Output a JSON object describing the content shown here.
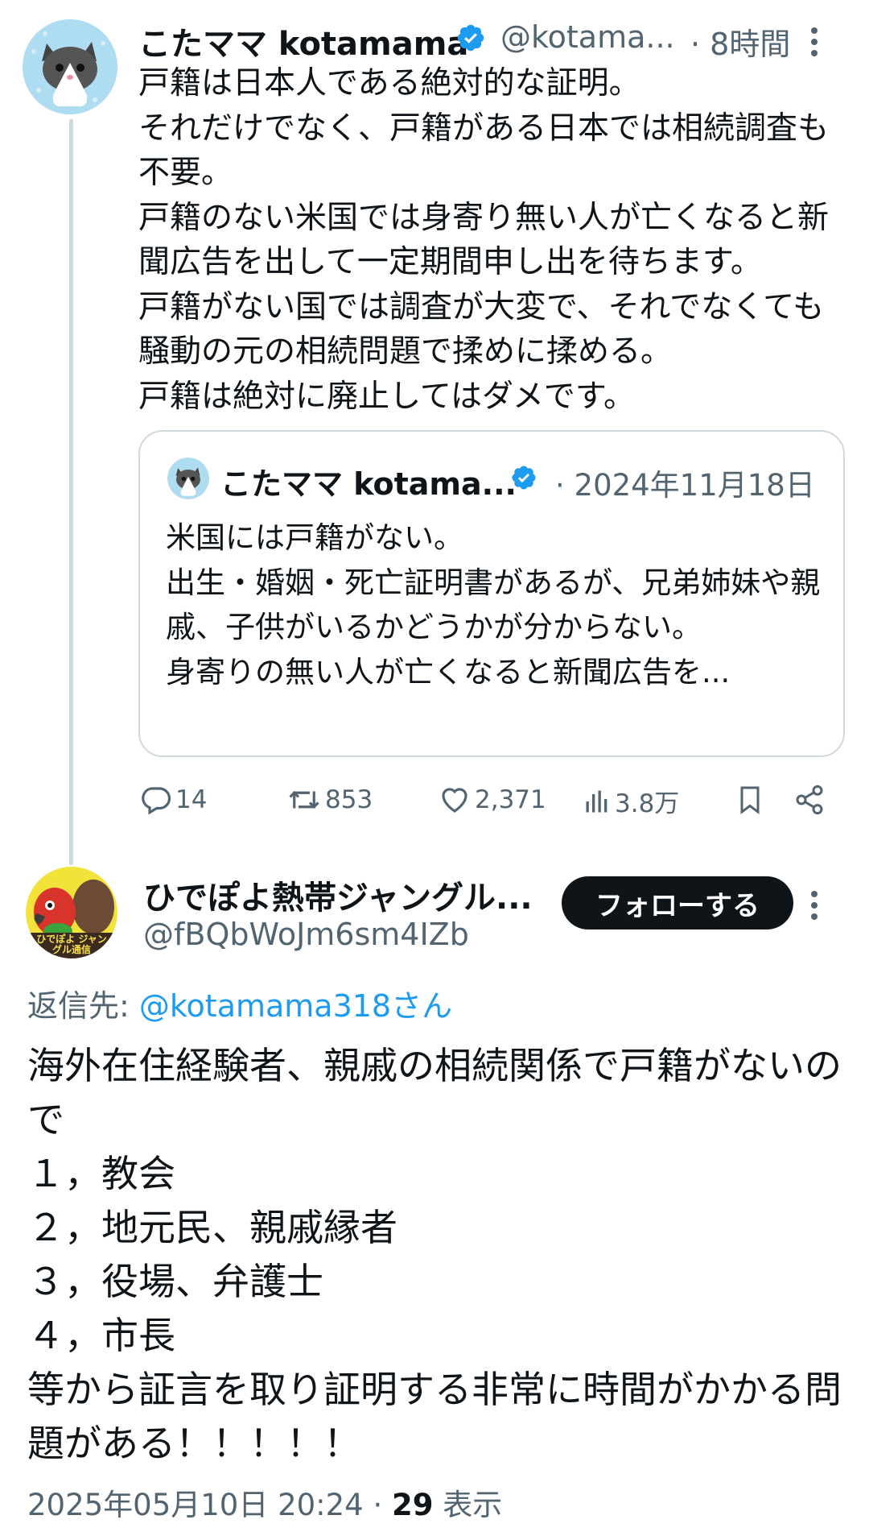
{
  "tweet": {
    "author_name": "こたママ kotamama",
    "author_handle": "@kotama...",
    "time": "· 8時間",
    "body": "戸籍は日本人である絶対的な証明。\nそれだけでなく、戸籍がある日本では相続調査も不要。\n戸籍のない米国では身寄り無い人が亡くなると新聞広告を出して一定期間申し出を待ちます。\n戸籍がない国では調査が大変で、それでなくても騒動の元の相続問題で揉めに揉める。\n戸籍は絶対に廃止してはダメです。",
    "quote": {
      "author_name": "こたママ kotama...",
      "date": "· 2024年11月18日",
      "body": "米国には戸籍がない。\n出生・婚姻・死亡証明書があるが、兄弟姉妹や親戚、子供がいるかどうかが分からない。\n身寄りの無い人が亡くなると新聞広告を..."
    },
    "actions": {
      "replies": "14",
      "retweets": "853",
      "likes": "2,371",
      "views": "3.8万"
    }
  },
  "reply": {
    "author_name": "ひでぽよ熱帯ジャングル...",
    "author_handle": "@fBQbWoJm6sm4IZb",
    "follow_label": "フォローする",
    "reply_to_prefix": "返信先: ",
    "reply_to_handle": "@kotamama318さん",
    "body": "海外在住経験者、親戚の相続関係で戸籍がないので\n１，教会\n２，地元民、親戚縁者\n３，役場、弁護士\n４，市長\n等から証言を取り証明する非常に時間がかかる問題がある！！！！！",
    "timestamp": "2025年05月10日 20:24 · ",
    "views_count": "29",
    "views_label": " 表示",
    "avatar_text": "ひでぽよ ジャングル通信"
  },
  "colors": {
    "verified": "#1d9bf0",
    "muted": "#536471",
    "link": "#1d9bf0",
    "follow_bg": "#0f1419"
  },
  "icons": [
    "verified-badge-icon",
    "more-icon",
    "reply-icon",
    "retweet-icon",
    "like-icon",
    "views-icon",
    "bookmark-icon",
    "share-icon"
  ]
}
